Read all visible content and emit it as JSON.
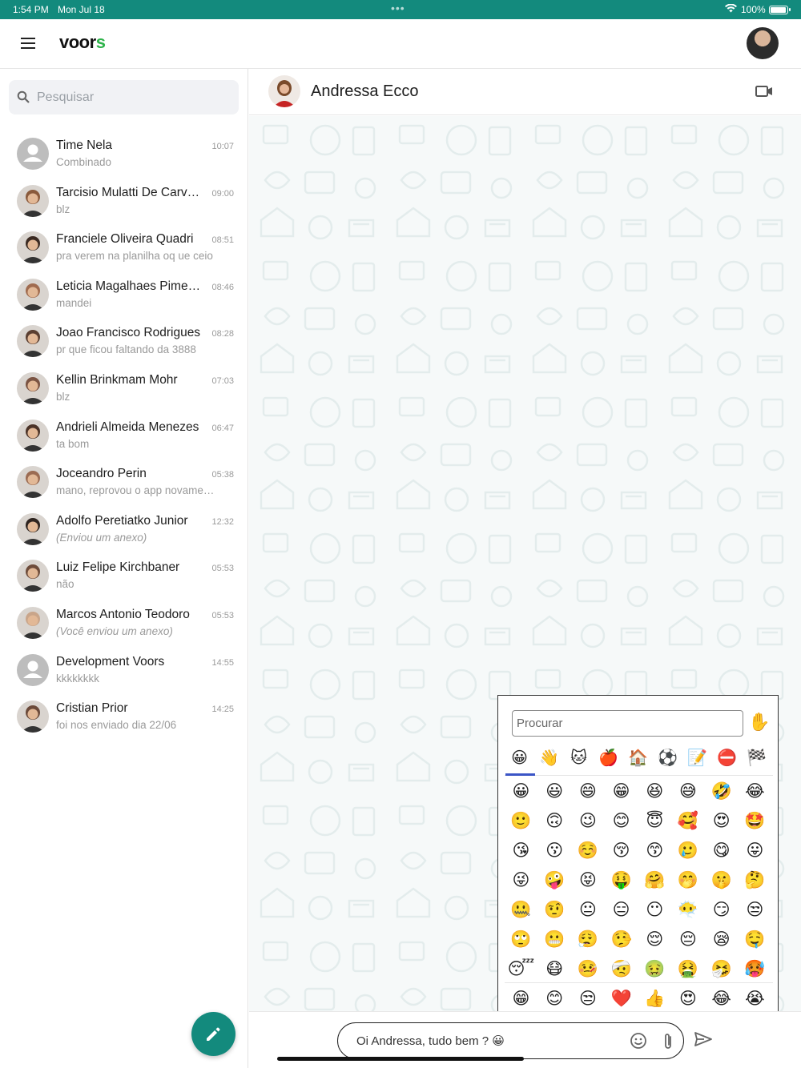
{
  "status_bar": {
    "time": "1:54 PM",
    "date": "Mon Jul 18",
    "battery": "100%",
    "battery_level": 1.0
  },
  "app": {
    "logo_text": "voor",
    "logo_accent": "s",
    "brand_color": "#138a7d"
  },
  "search": {
    "placeholder": "Pesquisar"
  },
  "chats": [
    {
      "name": "Time Nela",
      "time": "10:07",
      "preview": "Combinado",
      "avatar": "default"
    },
    {
      "name": "Tarcisio Mulatti De Carvalho",
      "time": "09:00",
      "preview": "blz",
      "avatar": "photo"
    },
    {
      "name": "Franciele Oliveira Quadri",
      "time": "08:51",
      "preview": "pra verem na planilha oq ue ceio",
      "avatar": "photo"
    },
    {
      "name": "Leticia Magalhaes Pimentel",
      "time": "08:46",
      "preview": "mandei",
      "avatar": "photo"
    },
    {
      "name": "Joao Francisco Rodrigues",
      "time": "08:28",
      "preview": "pr que ficou faltando da 3888",
      "avatar": "photo"
    },
    {
      "name": "Kellin Brinkmam Mohr",
      "time": "07:03",
      "preview": "blz",
      "avatar": "photo"
    },
    {
      "name": "Andrieli Almeida Menezes",
      "time": "06:47",
      "preview": "ta bom",
      "avatar": "photo"
    },
    {
      "name": "Joceandro Perin",
      "time": "05:38",
      "preview": "mano, reprovou o app novamente",
      "avatar": "photo"
    },
    {
      "name": "Adolfo Peretiatko Junior",
      "time": "12:32",
      "preview": "(Enviou um anexo)",
      "avatar": "photo",
      "italic": true
    },
    {
      "name": "Luiz Felipe Kirchbaner",
      "time": "05:53",
      "preview": "não",
      "avatar": "photo"
    },
    {
      "name": "Marcos Antonio Teodoro",
      "time": "05:53",
      "preview": "(Você enviou um anexo)",
      "avatar": "photo",
      "italic": true
    },
    {
      "name": "Development Voors",
      "time": "14:55",
      "preview": "kkkkkkkk",
      "avatar": "default"
    },
    {
      "name": "Cristian Prior",
      "time": "14:25",
      "preview": "foi nos enviado dia 22/06",
      "avatar": "photo"
    }
  ],
  "conversation": {
    "contact_name": "Andressa Ecco"
  },
  "composer": {
    "message": "Oi Andressa, tudo bem ? 😀"
  },
  "emoji_picker": {
    "search_placeholder": "Procurar",
    "skin_tone": "✋",
    "categories": [
      "😀",
      "👋",
      "🐱",
      "🍎",
      "🏠",
      "⚽",
      "📝",
      "⛔",
      "🏁"
    ],
    "emojis": [
      "😀",
      "😃",
      "😄",
      "😁",
      "😆",
      "😅",
      "🤣",
      "😂",
      "🙂",
      "🙃",
      "😉",
      "😊",
      "😇",
      "🥰",
      "😍",
      "🤩",
      "😘",
      "😗",
      "☺️",
      "😚",
      "😙",
      "🥲",
      "😋",
      "😛",
      "😜",
      "🤪",
      "😝",
      "🤑",
      "🤗",
      "🤭",
      "🤫",
      "🤔",
      "🤐",
      "🤨",
      "😐",
      "😑",
      "😶",
      "😶‍🌫️",
      "😏",
      "😒",
      "🙄",
      "😬",
      "😮‍💨",
      "🤥",
      "😌",
      "😔",
      "😪",
      "🤤",
      "😴",
      "😷",
      "🤒",
      "🤕",
      "🤢",
      "🤮",
      "🤧",
      "🥵"
    ],
    "recent": [
      "😁",
      "😊",
      "😒",
      "❤️",
      "👍",
      "😍",
      "😂",
      "😭"
    ]
  }
}
